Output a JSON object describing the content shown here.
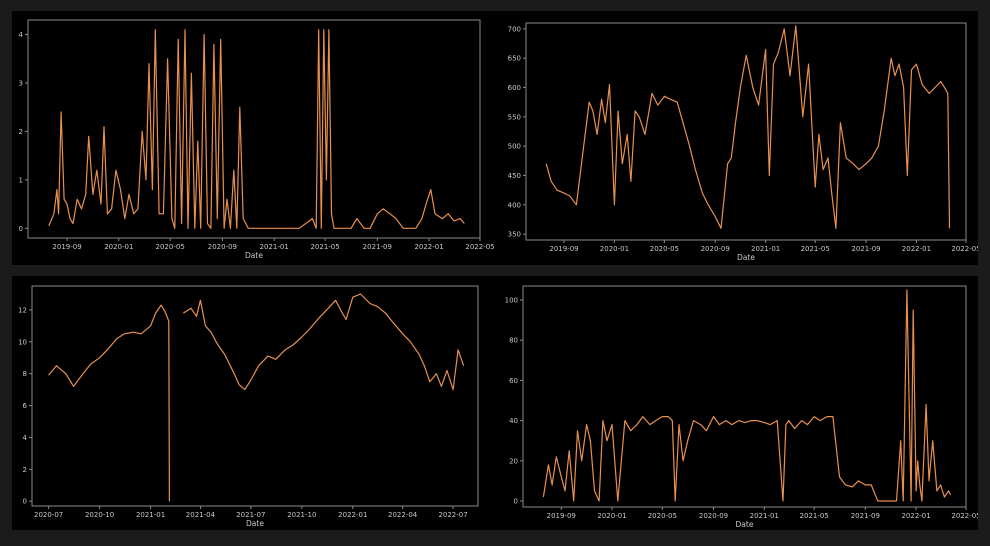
{
  "style": {
    "background": "#000000",
    "line_color": "#e8904e",
    "frame_color": "#8a8a8a",
    "text_color": "#c8c8c8"
  },
  "chart_data": [
    {
      "type": "line",
      "title": "",
      "xlabel": "Date",
      "ylabel": "",
      "xlim": [
        "2019-06-01",
        "2022-05-01"
      ],
      "ylim": [
        -0.2,
        4.3
      ],
      "x_ticks": [
        "2019-09",
        "2020-01",
        "2020-05",
        "2020-09",
        "2021-01",
        "2021-05",
        "2021-09",
        "2022-01",
        "2022-05"
      ],
      "y_ticks": [
        "0",
        "1",
        "2",
        "3",
        "4"
      ],
      "series": [
        {
          "x": [
            "2019-07-20",
            "2019-08-01",
            "2019-08-08",
            "2019-08-12",
            "2019-08-18",
            "2019-08-25",
            "2019-09-01",
            "2019-09-08",
            "2019-09-15",
            "2019-09-25",
            "2019-10-05",
            "2019-10-15",
            "2019-10-22",
            "2019-11-01",
            "2019-11-10",
            "2019-11-20",
            "2019-11-27",
            "2019-12-05",
            "2019-12-15",
            "2019-12-25",
            "2020-01-05",
            "2020-01-15",
            "2020-01-25",
            "2020-02-05",
            "2020-02-15",
            "2020-02-25",
            "2020-03-05",
            "2020-03-12",
            "2020-03-20",
            "2020-03-27",
            "2020-04-05",
            "2020-04-15",
            "2020-04-25",
            "2020-05-05",
            "2020-05-12",
            "2020-05-20",
            "2020-05-28",
            "2020-06-05",
            "2020-06-12",
            "2020-06-20",
            "2020-06-28",
            "2020-07-05",
            "2020-07-12",
            "2020-07-20",
            "2020-07-28",
            "2020-08-05",
            "2020-08-12",
            "2020-08-20",
            "2020-08-28",
            "2020-09-05",
            "2020-09-12",
            "2020-09-20",
            "2020-09-28",
            "2020-10-05",
            "2020-10-12",
            "2020-10-20",
            "2020-11-01",
            "2020-12-01",
            "2021-01-01",
            "2021-02-01",
            "2021-03-01",
            "2021-04-01",
            "2021-04-10",
            "2021-04-16",
            "2021-04-22",
            "2021-04-28",
            "2021-05-04",
            "2021-05-10",
            "2021-05-16",
            "2021-05-22",
            "2021-06-01",
            "2021-06-15",
            "2021-07-01",
            "2021-07-15",
            "2021-08-01",
            "2021-08-15",
            "2021-09-01",
            "2021-09-15",
            "2021-10-01",
            "2021-10-15",
            "2021-11-01",
            "2021-11-15",
            "2021-12-01",
            "2021-12-15",
            "2021-12-25",
            "2022-01-05",
            "2022-01-15",
            "2022-02-01",
            "2022-02-15",
            "2022-03-01",
            "2022-03-15",
            "2022-03-25"
          ],
          "values": [
            0.05,
            0.3,
            0.8,
            0.3,
            2.4,
            0.6,
            0.5,
            0.2,
            0.1,
            0.6,
            0.4,
            0.7,
            1.9,
            0.7,
            1.2,
            0.5,
            2.1,
            0.3,
            0.4,
            1.2,
            0.8,
            0.2,
            0.7,
            0.3,
            0.4,
            2.0,
            1.0,
            3.4,
            0.8,
            4.1,
            0.3,
            0.3,
            3.5,
            0.2,
            0.0,
            3.9,
            0.1,
            4.1,
            0.0,
            3.2,
            0.0,
            1.8,
            0.0,
            4.0,
            0.1,
            0.0,
            3.8,
            0.2,
            3.9,
            0.0,
            0.6,
            0.0,
            1.2,
            0.0,
            2.5,
            0.2,
            0.0,
            0.0,
            0.0,
            0.0,
            0.0,
            0.2,
            0.0,
            4.1,
            0.0,
            4.1,
            1.0,
            4.1,
            0.3,
            0.0,
            0.0,
            0.0,
            0.0,
            0.2,
            0.0,
            0.0,
            0.3,
            0.4,
            0.3,
            0.2,
            0.0,
            0.0,
            0.0,
            0.2,
            0.5,
            0.8,
            0.3,
            0.2,
            0.3,
            0.15,
            0.2,
            0.1
          ]
        }
      ]
    },
    {
      "type": "line",
      "title": "",
      "xlabel": "Date",
      "ylabel": "",
      "xlim": [
        "2019-06-01",
        "2022-05-01"
      ],
      "ylim": [
        340,
        710
      ],
      "x_ticks": [
        "2019-09",
        "2020-01",
        "2020-05",
        "2020-09",
        "2021-01",
        "2021-05",
        "2021-09",
        "2022-01",
        "2022-05"
      ],
      "y_ticks": [
        "350",
        "400",
        "450",
        "500",
        "550",
        "600",
        "650",
        "700"
      ],
      "series": [
        {
          "x": [
            "2019-07-20",
            "2019-08-01",
            "2019-08-15",
            "2019-09-01",
            "2019-09-15",
            "2019-10-01",
            "2019-10-15",
            "2019-11-01",
            "2019-11-10",
            "2019-11-20",
            "2019-12-01",
            "2019-12-10",
            "2019-12-20",
            "2020-01-01",
            "2020-01-10",
            "2020-01-20",
            "2020-02-01",
            "2020-02-10",
            "2020-02-20",
            "2020-03-01",
            "2020-03-15",
            "2020-04-01",
            "2020-04-15",
            "2020-05-01",
            "2020-05-15",
            "2020-06-01",
            "2020-06-15",
            "2020-07-01",
            "2020-07-15",
            "2020-08-01",
            "2020-08-15",
            "2020-09-01",
            "2020-09-15",
            "2020-10-01",
            "2020-10-10",
            "2020-10-20",
            "2020-11-01",
            "2020-11-15",
            "2020-12-01",
            "2020-12-15",
            "2021-01-01",
            "2021-01-10",
            "2021-01-20",
            "2021-02-01",
            "2021-02-15",
            "2021-03-01",
            "2021-03-15",
            "2021-04-01",
            "2021-04-15",
            "2021-05-01",
            "2021-05-10",
            "2021-05-20",
            "2021-06-01",
            "2021-06-10",
            "2021-06-20",
            "2021-07-01",
            "2021-07-15",
            "2021-08-01",
            "2021-08-15",
            "2021-09-01",
            "2021-09-15",
            "2021-10-01",
            "2021-10-15",
            "2021-11-01",
            "2021-11-10",
            "2021-11-20",
            "2021-12-01",
            "2021-12-10",
            "2021-12-20",
            "2022-01-01",
            "2022-01-15",
            "2022-02-01",
            "2022-02-15",
            "2022-03-01",
            "2022-03-10",
            "2022-03-18",
            "2022-03-22"
          ],
          "values": [
            470,
            440,
            425,
            420,
            415,
            400,
            480,
            575,
            560,
            520,
            580,
            540,
            605,
            400,
            560,
            470,
            520,
            440,
            560,
            550,
            520,
            590,
            570,
            585,
            580,
            575,
            540,
            500,
            460,
            420,
            400,
            380,
            360,
            470,
            480,
            540,
            600,
            655,
            600,
            570,
            665,
            450,
            640,
            660,
            700,
            620,
            705,
            550,
            640,
            430,
            520,
            460,
            480,
            420,
            360,
            540,
            480,
            470,
            460,
            470,
            480,
            500,
            560,
            650,
            620,
            640,
            600,
            450,
            630,
            640,
            605,
            590,
            600,
            610,
            600,
            590,
            360
          ]
        }
      ]
    },
    {
      "type": "line",
      "title": "",
      "xlabel": "Date",
      "ylabel": "",
      "xlim": [
        "2020-06-01",
        "2022-08-15"
      ],
      "ylim": [
        -0.3,
        13.5
      ],
      "x_ticks": [
        "2020-07",
        "2020-10",
        "2021-01",
        "2021-04",
        "2021-07",
        "2021-10",
        "2022-01",
        "2022-04",
        "2022-07"
      ],
      "y_ticks": [
        "0",
        "2",
        "4",
        "6",
        "8",
        "10",
        "12"
      ],
      "series": [
        {
          "x": [
            "2020-07-01",
            "2020-07-15",
            "2020-08-01",
            "2020-08-15",
            "2020-09-01",
            "2020-09-15",
            "2020-10-01",
            "2020-10-15",
            "2020-11-01",
            "2020-11-15",
            "2020-12-01",
            "2020-12-15",
            "2021-01-01",
            "2021-01-10",
            "2021-01-20",
            "2021-01-27",
            "2021-02-03",
            "2021-02-04",
            "2021-02-10",
            "2021-03-01",
            "2021-03-15",
            "2021-03-25",
            "2021-04-01",
            "2021-04-10",
            "2021-04-20",
            "2021-05-01",
            "2021-05-15",
            "2021-06-01",
            "2021-06-10",
            "2021-06-20",
            "2021-07-01",
            "2021-07-15",
            "2021-08-01",
            "2021-08-15",
            "2021-09-01",
            "2021-09-15",
            "2021-10-01",
            "2021-10-15",
            "2021-11-01",
            "2021-11-15",
            "2021-12-01",
            "2021-12-10",
            "2021-12-20",
            "2022-01-01",
            "2022-01-15",
            "2022-02-01",
            "2022-02-15",
            "2022-03-01",
            "2022-03-15",
            "2022-04-01",
            "2022-04-15",
            "2022-05-01",
            "2022-05-10",
            "2022-05-20",
            "2022-06-01",
            "2022-06-10",
            "2022-06-20",
            "2022-07-01",
            "2022-07-10",
            "2022-07-20"
          ],
          "values": [
            7.9,
            8.5,
            8.0,
            7.2,
            8.0,
            8.6,
            9.0,
            9.5,
            10.2,
            10.5,
            10.6,
            10.5,
            11.0,
            11.8,
            12.3,
            11.9,
            11.3,
            0.0,
            null,
            11.8,
            12.1,
            11.6,
            12.6,
            11.0,
            10.6,
            9.9,
            9.2,
            8.0,
            7.3,
            7.0,
            7.6,
            8.5,
            9.1,
            8.9,
            9.5,
            9.8,
            10.3,
            10.8,
            11.5,
            12.0,
            12.6,
            12.0,
            11.4,
            12.8,
            13.0,
            12.4,
            12.2,
            11.8,
            11.2,
            10.5,
            10.0,
            9.2,
            8.5,
            7.5,
            8.0,
            7.2,
            8.2,
            7.0,
            9.5,
            8.5
          ]
        }
      ]
    },
    {
      "type": "line",
      "title": "",
      "xlabel": "Date",
      "ylabel": "",
      "xlim": [
        "2019-06-01",
        "2022-05-01"
      ],
      "ylim": [
        -3,
        107
      ],
      "x_ticks": [
        "2019-09",
        "2020-01",
        "2020-05",
        "2020-09",
        "2021-01",
        "2021-05",
        "2021-09",
        "2022-01",
        "2022-05"
      ],
      "y_ticks": [
        "0",
        "20",
        "40",
        "60",
        "80",
        "100"
      ],
      "series": [
        {
          "x": [
            "2019-07-20",
            "2019-08-01",
            "2019-08-10",
            "2019-08-20",
            "2019-09-01",
            "2019-09-10",
            "2019-09-20",
            "2019-10-01",
            "2019-10-10",
            "2019-10-20",
            "2019-11-01",
            "2019-11-10",
            "2019-11-20",
            "2019-12-01",
            "2019-12-10",
            "2019-12-20",
            "2020-01-01",
            "2020-01-15",
            "2020-02-01",
            "2020-02-15",
            "2020-03-01",
            "2020-03-15",
            "2020-04-01",
            "2020-04-15",
            "2020-05-01",
            "2020-05-15",
            "2020-05-25",
            "2020-06-01",
            "2020-06-10",
            "2020-06-20",
            "2020-07-01",
            "2020-07-15",
            "2020-08-01",
            "2020-08-15",
            "2020-09-01",
            "2020-09-15",
            "2020-10-01",
            "2020-10-15",
            "2020-11-01",
            "2020-11-15",
            "2020-12-01",
            "2020-12-15",
            "2021-01-01",
            "2021-01-15",
            "2021-02-01",
            "2021-02-15",
            "2021-02-22",
            "2021-03-01",
            "2021-03-15",
            "2021-04-01",
            "2021-04-15",
            "2021-05-01",
            "2021-05-15",
            "2021-06-01",
            "2021-06-15",
            "2021-07-01",
            "2021-07-15",
            "2021-08-01",
            "2021-08-15",
            "2021-09-01",
            "2021-09-15",
            "2021-10-01",
            "2021-10-15",
            "2021-11-01",
            "2021-11-15",
            "2021-11-25",
            "2021-12-01",
            "2021-12-10",
            "2021-12-20",
            "2021-12-25",
            "2022-01-01",
            "2022-01-05",
            "2022-01-10",
            "2022-01-15",
            "2022-01-25",
            "2022-02-01",
            "2022-02-10",
            "2022-02-20",
            "2022-03-01",
            "2022-03-10",
            "2022-03-20",
            "2022-03-25"
          ],
          "values": [
            2,
            18,
            8,
            22,
            12,
            5,
            25,
            0,
            35,
            20,
            38,
            30,
            5,
            0,
            40,
            30,
            38,
            0,
            40,
            35,
            38,
            42,
            38,
            40,
            42,
            42,
            40,
            0,
            38,
            20,
            30,
            40,
            38,
            35,
            42,
            38,
            40,
            38,
            40,
            39,
            40,
            40,
            39,
            38,
            40,
            0,
            38,
            40,
            36,
            40,
            38,
            42,
            40,
            42,
            42,
            12,
            8,
            7,
            10,
            8,
            8,
            0,
            0,
            0,
            0,
            30,
            0,
            105,
            0,
            95,
            5,
            20,
            8,
            0,
            48,
            10,
            30,
            5,
            8,
            2,
            5,
            3
          ]
        }
      ]
    }
  ]
}
